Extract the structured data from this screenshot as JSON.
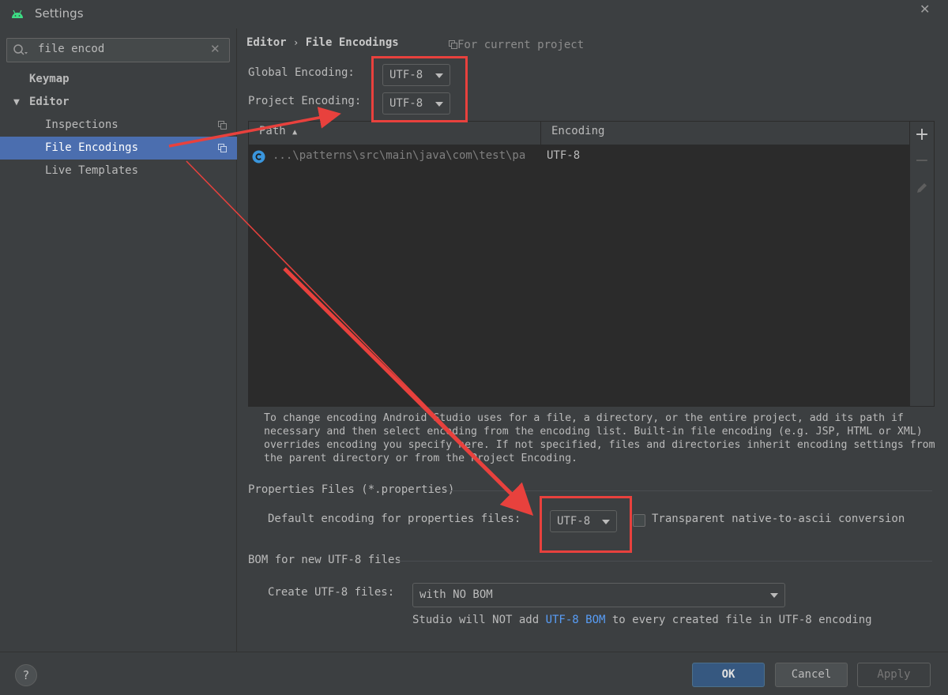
{
  "window": {
    "title": "Settings"
  },
  "sidebar": {
    "search_value": "file encod",
    "items": [
      {
        "label": "Keymap"
      },
      {
        "label": "Editor"
      },
      {
        "label": "Inspections"
      },
      {
        "label": "File Encodings"
      },
      {
        "label": "Live Templates"
      }
    ]
  },
  "breadcrumb": {
    "parent": "Editor",
    "separator": "›",
    "current": "File Encodings"
  },
  "scope_note": "For current project",
  "encodings": {
    "global_label": "Global Encoding:",
    "global_value": "UTF-8",
    "project_label": "Project Encoding:",
    "project_value": "UTF-8"
  },
  "table": {
    "col_path": "Path",
    "col_encoding": "Encoding",
    "rows": [
      {
        "path": "...\\patterns\\src\\main\\java\\com\\test\\pa",
        "encoding": "UTF-8"
      }
    ]
  },
  "help_text": "To change encoding Android Studio uses for a file, a directory, or the entire project, add its path if necessary and then select encoding from the encoding list. Built-in file encoding (e.g. JSP, HTML or XML) overrides encoding you specify here. If not specified, files and directories inherit encoding settings from the parent directory or from the Project Encoding.",
  "properties": {
    "section_title": "Properties Files (*.properties)",
    "default_label": "Default encoding for properties files:",
    "default_value": "UTF-8",
    "transparent_label": "Transparent native-to-ascii conversion",
    "transparent_checked": false
  },
  "bom": {
    "section_title": "BOM for new UTF-8 files",
    "create_label": "Create UTF-8 files:",
    "create_value": "with NO BOM",
    "note_prefix": "Studio will NOT add ",
    "note_link": "UTF-8 BOM",
    "note_suffix": " to every created file in UTF-8 encoding"
  },
  "buttons": {
    "ok": "OK",
    "cancel": "Cancel",
    "apply": "Apply",
    "help": "?"
  },
  "colors": {
    "annotation_red": "#e8413d",
    "selection": "#4b6eaf",
    "link": "#589df6"
  }
}
